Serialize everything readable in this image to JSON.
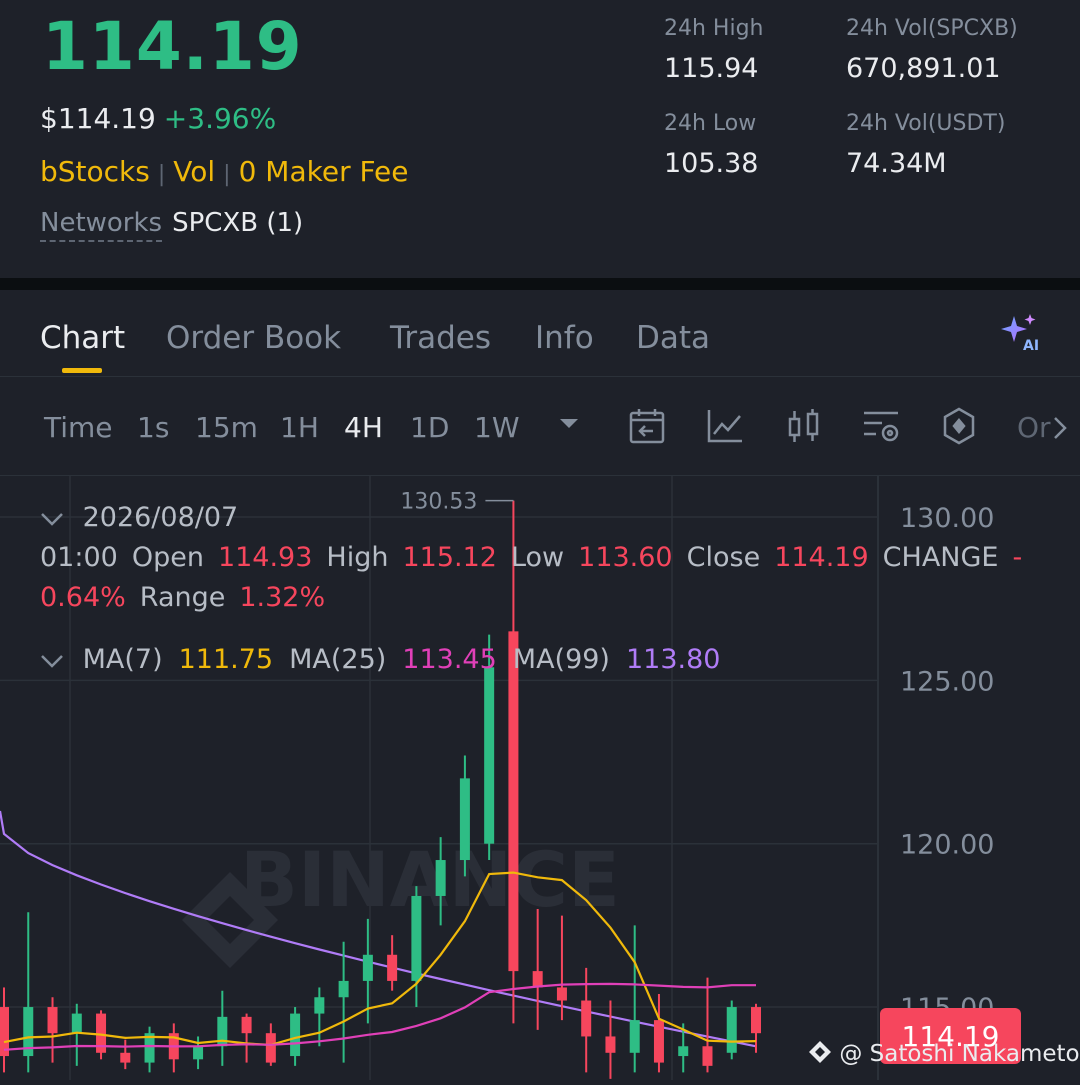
{
  "header": {
    "price": "114.19",
    "usd_price": "$114.19",
    "change_pct": "+3.96%",
    "tags": [
      "bStocks",
      "Vol",
      "0 Maker Fee"
    ],
    "networks_label": "Networks",
    "networks_value": "SPCXB (1)",
    "stats": {
      "high_label": "24h High",
      "high_value": "115.94",
      "low_label": "24h Low",
      "low_value": "105.38",
      "vol_base_label": "24h Vol(SPCXB)",
      "vol_base_value": "670,891.01",
      "vol_quote_label": "24h Vol(USDT)",
      "vol_quote_value": "74.34M"
    }
  },
  "tabs": [
    "Chart",
    "Order Book",
    "Trades",
    "Info",
    "Data"
  ],
  "ai_label": "AI",
  "timeframes": {
    "label": "Time",
    "options": [
      "1s",
      "15m",
      "1H",
      "4H",
      "1D",
      "1W"
    ],
    "selected": "4H",
    "more_label": "Or"
  },
  "ohlc": {
    "date": "2026/08/07 01:00",
    "open_label": "Open",
    "open": "114.93",
    "high_label": "High",
    "high": "115.12",
    "low_label": "Low",
    "low": "113.60",
    "close_label": "Close",
    "close": "114.19",
    "change_label": "CHANGE",
    "change": "-0.64%",
    "range_label": "Range",
    "range": "1.32%"
  },
  "ma": {
    "ma7_label": "MA(7)",
    "ma7": "111.75",
    "ma25_label": "MA(25)",
    "ma25": "113.45",
    "ma99_label": "MA(99)",
    "ma99": "113.80"
  },
  "colors": {
    "up": "#2ebd85",
    "down": "#f6465d",
    "accent": "#f0b90b",
    "ma7": "#f0b90b",
    "ma25": "#e040b8",
    "ma99": "#b07cf7"
  },
  "chart_data": {
    "type": "candlestick",
    "y_ticks": [
      "130.00",
      "125.00",
      "120.00",
      "115.00"
    ],
    "ylim": [
      113.2,
      131.0
    ],
    "high_marker": "130.53",
    "last_price": "114.19",
    "candles": [
      {
        "o": 115.0,
        "h": 115.6,
        "l": 113.0,
        "c": 113.5
      },
      {
        "o": 113.5,
        "h": 117.9,
        "l": 113.0,
        "c": 115.0
      },
      {
        "o": 115.0,
        "h": 115.3,
        "l": 113.3,
        "c": 114.2
      },
      {
        "o": 114.2,
        "h": 115.1,
        "l": 113.2,
        "c": 114.8
      },
      {
        "o": 114.8,
        "h": 114.9,
        "l": 113.4,
        "c": 113.6
      },
      {
        "o": 113.6,
        "h": 114.0,
        "l": 113.1,
        "c": 113.3
      },
      {
        "o": 113.3,
        "h": 114.4,
        "l": 113.0,
        "c": 114.2
      },
      {
        "o": 114.2,
        "h": 114.5,
        "l": 113.0,
        "c": 113.4
      },
      {
        "o": 113.4,
        "h": 114.1,
        "l": 113.1,
        "c": 113.8
      },
      {
        "o": 113.8,
        "h": 115.5,
        "l": 113.2,
        "c": 114.7
      },
      {
        "o": 114.7,
        "h": 114.8,
        "l": 113.3,
        "c": 114.2
      },
      {
        "o": 114.2,
        "h": 114.5,
        "l": 113.2,
        "c": 113.3
      },
      {
        "o": 113.5,
        "h": 115.0,
        "l": 113.2,
        "c": 114.8
      },
      {
        "o": 114.8,
        "h": 115.6,
        "l": 113.8,
        "c": 115.3
      },
      {
        "o": 115.3,
        "h": 117.0,
        "l": 113.3,
        "c": 115.8
      },
      {
        "o": 115.8,
        "h": 117.7,
        "l": 114.5,
        "c": 116.6
      },
      {
        "o": 116.6,
        "h": 117.2,
        "l": 115.5,
        "c": 115.8
      },
      {
        "o": 115.8,
        "h": 118.7,
        "l": 115.0,
        "c": 118.4
      },
      {
        "o": 118.4,
        "h": 120.2,
        "l": 117.5,
        "c": 119.5
      },
      {
        "o": 119.5,
        "h": 122.7,
        "l": 119.0,
        "c": 122.0
      },
      {
        "o": 120.0,
        "h": 126.4,
        "l": 119.5,
        "c": 125.4
      },
      {
        "o": 126.5,
        "h": 130.5,
        "l": 114.5,
        "c": 116.1
      },
      {
        "o": 116.1,
        "h": 118.0,
        "l": 114.3,
        "c": 115.6
      },
      {
        "o": 115.6,
        "h": 117.8,
        "l": 114.6,
        "c": 115.2
      },
      {
        "o": 115.2,
        "h": 116.2,
        "l": 113.0,
        "c": 114.1
      },
      {
        "o": 114.1,
        "h": 115.2,
        "l": 112.8,
        "c": 113.6
      },
      {
        "o": 113.6,
        "h": 117.5,
        "l": 113.0,
        "c": 114.6
      },
      {
        "o": 114.6,
        "h": 115.4,
        "l": 113.0,
        "c": 113.3
      },
      {
        "o": 113.5,
        "h": 114.5,
        "l": 113.0,
        "c": 113.8
      },
      {
        "o": 113.8,
        "h": 115.9,
        "l": 113.0,
        "c": 113.2
      },
      {
        "o": 113.6,
        "h": 115.2,
        "l": 113.4,
        "c": 115.0
      },
      {
        "o": 115.0,
        "h": 115.1,
        "l": 113.6,
        "c": 114.2
      }
    ]
  },
  "last_price_tag": "114.19",
  "watermark": "@ Satoshi Nakameto"
}
